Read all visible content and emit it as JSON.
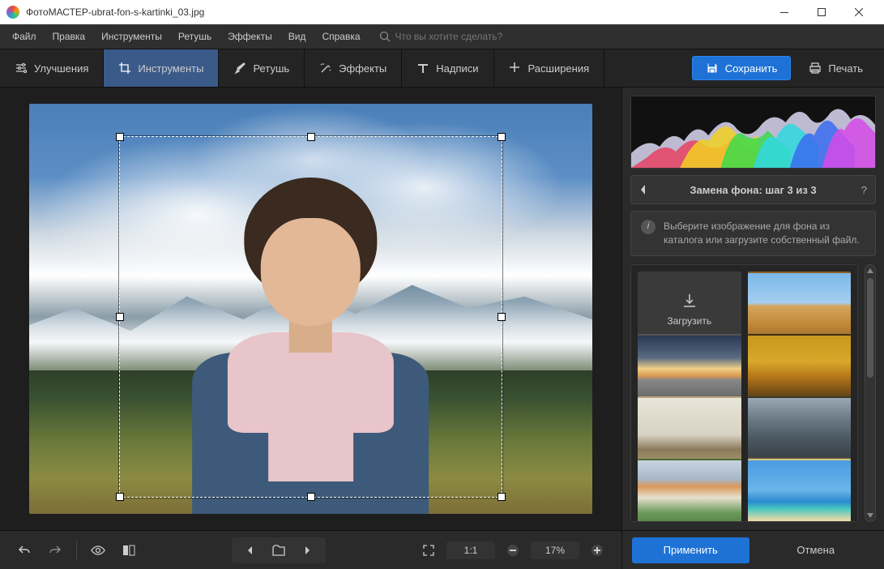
{
  "titlebar": {
    "app": "ФотоМАСТЕР",
    "sep": " - ",
    "file": "ubrat-fon-s-kartinki_03.jpg"
  },
  "menu": {
    "items": [
      "Файл",
      "Правка",
      "Инструменты",
      "Ретушь",
      "Эффекты",
      "Вид",
      "Справка"
    ],
    "search_placeholder": "Что вы хотите сделать?"
  },
  "toolbar": {
    "tabs": [
      {
        "label": "Улучшения",
        "active": false
      },
      {
        "label": "Инструменты",
        "active": true
      },
      {
        "label": "Ретушь",
        "active": false
      },
      {
        "label": "Эффекты",
        "active": false
      },
      {
        "label": "Надписи",
        "active": false
      },
      {
        "label": "Расширения",
        "active": false
      }
    ],
    "save_label": "Сохранить",
    "print_label": "Печать"
  },
  "bottombar": {
    "ratio_label": "1:1",
    "zoom_label": "17%"
  },
  "panel": {
    "title": "Замена фона: шаг 3 из 3",
    "help": "?",
    "info": "Выберите изображение для фона из каталога или загрузите собственный файл.",
    "load_label": "Загрузить"
  },
  "footer": {
    "apply": "Применить",
    "cancel": "Отмена"
  }
}
